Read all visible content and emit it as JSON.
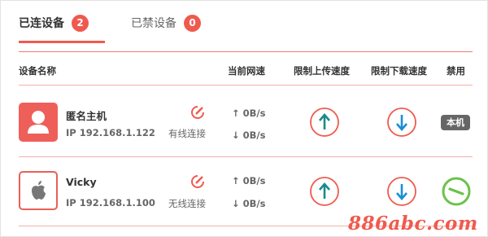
{
  "tabs": [
    {
      "label": "已连设备",
      "count": "2"
    },
    {
      "label": "已禁设备",
      "count": "0"
    }
  ],
  "columns": {
    "device_name": "设备名称",
    "current_speed": "当前网速",
    "limit_upload": "限制上传速度",
    "limit_download": "限制下载速度",
    "disable": "禁用"
  },
  "devices": [
    {
      "name": "匿名主机",
      "ip": "IP 192.168.1.122",
      "connection": "有线连接",
      "upload_speed": "↑ 0B/s",
      "download_speed": "↓ 0B/s",
      "disable_label": "本机",
      "avatar_icon": "user-icon"
    },
    {
      "name": "Vicky",
      "ip": "IP 192.168.1.100",
      "connection": "无线连接",
      "upload_speed": "↑ 0B/s",
      "download_speed": "↓ 0B/s",
      "disable_label": "",
      "avatar_icon": "apple-icon"
    }
  ],
  "watermark": "886abc.com",
  "colors": {
    "accent": "#ef5a4e",
    "upload_arrow": "#1a8a8a",
    "download_arrow": "#1a8fd6",
    "disable_green": "#6cc24a"
  }
}
